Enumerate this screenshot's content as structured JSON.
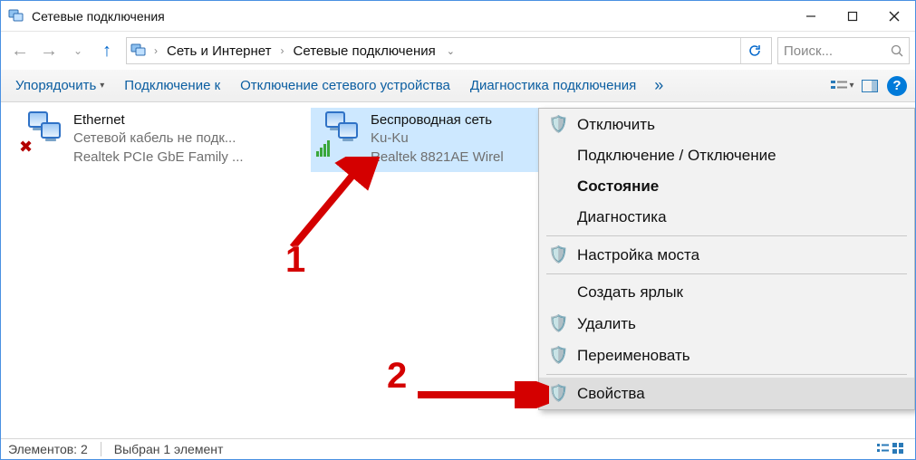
{
  "window": {
    "title": "Сетевые подключения"
  },
  "breadcrumbs": {
    "level1": "Сеть и Интернет",
    "level2": "Сетевые подключения"
  },
  "search": {
    "placeholder": "Поиск..."
  },
  "toolbar": {
    "organize": "Упорядочить",
    "connect_to": "Подключение к",
    "disable_device": "Отключение сетевого устройства",
    "diagnose": "Диагностика подключения"
  },
  "connections": {
    "ethernet": {
      "name": "Ethernet",
      "status": "Сетевой кабель не подк...",
      "device": "Realtek PCIe GbE Family ..."
    },
    "wifi": {
      "name": "Беспроводная сеть",
      "ssid": "Ku-Ku",
      "device": "Realtek 8821AE Wirel"
    }
  },
  "context_menu": {
    "disable": "Отключить",
    "connect_disconnect": "Подключение / Отключение",
    "status": "Состояние",
    "diagnostics": "Диагностика",
    "bridge_config": "Настройка моста",
    "create_shortcut": "Создать ярлык",
    "delete": "Удалить",
    "rename": "Переименовать",
    "properties": "Свойства"
  },
  "statusbar": {
    "items": "Элементов: 2",
    "selected": "Выбран 1 элемент"
  },
  "annotations": {
    "one": "1",
    "two": "2"
  }
}
